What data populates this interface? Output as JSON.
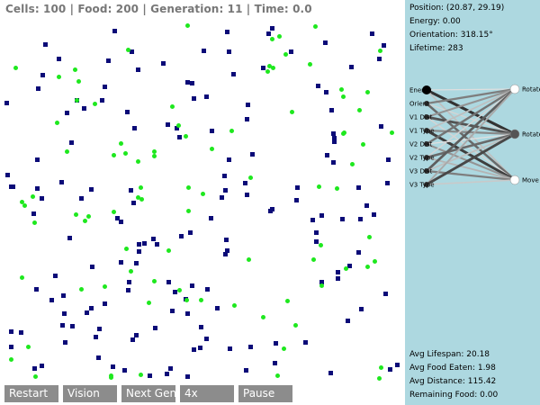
{
  "status": {
    "text": "Cells: 100 | Food: 200 | Generation: 11 | Time: 0.0"
  },
  "colors": {
    "cell": "#0b0b78",
    "food": "#1ee81e",
    "panel_bg": "#add8e0",
    "button_bg": "#8c8c8c"
  },
  "selected_cell": {
    "position": "Position: (20.87, 29.19)",
    "energy": "Energy: 0.00",
    "orientation": "Orientation: 318.15°",
    "lifetime": "Lifetime: 283"
  },
  "network": {
    "inputs": [
      "Energy",
      "Orient",
      "V1 Dist",
      "V1 Type",
      "V2 Dist",
      "V2 Type",
      "V3 Dist",
      "V3 Type"
    ],
    "outputs": [
      "Rotate",
      "Rotate",
      "Move"
    ]
  },
  "averages": {
    "lifespan": "Avg Lifespan: 20.18",
    "food_eaten": "Avg Food Eaten: 1.98",
    "distance": "Avg Distance: 115.42",
    "remaining_food": "Remaining Food: 0.00"
  },
  "buttons": {
    "restart": "Restart",
    "vision": "Vision",
    "next_gen": "Next Gen",
    "speed": "4x",
    "pause": "Pause"
  }
}
